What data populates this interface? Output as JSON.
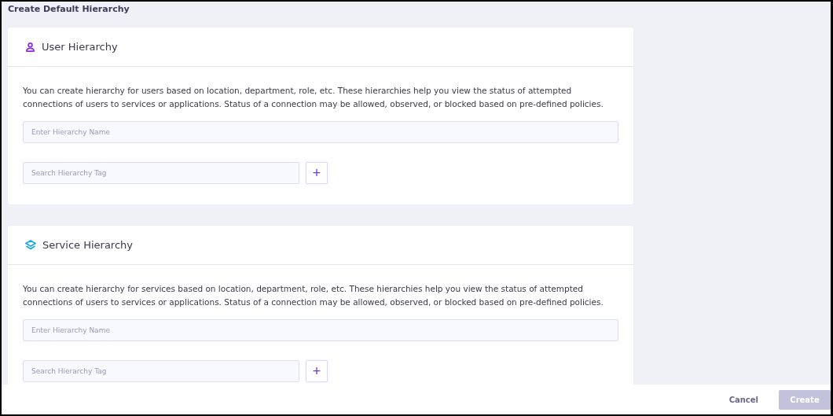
{
  "page_title": "Create Default Hierarchy",
  "cards": [
    {
      "kind": "user",
      "title": "User Hierarchy",
      "description": "You can create hierarchy for users based on location, department, role, etc. These hierarchies help you view the status of attempted connections of users to services or applications. Status of a connection may be allowed, observed, or blocked based on pre-defined policies.",
      "name_placeholder": "Enter Hierarchy Name",
      "tag_placeholder": "Search Hierarchy Tag",
      "add_label": "+"
    },
    {
      "kind": "service",
      "title": "Service Hierarchy",
      "description": "You can create hierarchy for services based on location, department, role, etc. These hierarchies help you view the status of attempted connections of users to services or applications. Status of a connection may be allowed, observed, or blocked based on pre-defined policies.",
      "name_placeholder": "Enter Hierarchy Name",
      "tag_placeholder": "Search Hierarchy Tag",
      "add_label": "+"
    }
  ],
  "footer": {
    "cancel": "Cancel",
    "create": {
      "label": "Create",
      "disabled": true
    }
  }
}
